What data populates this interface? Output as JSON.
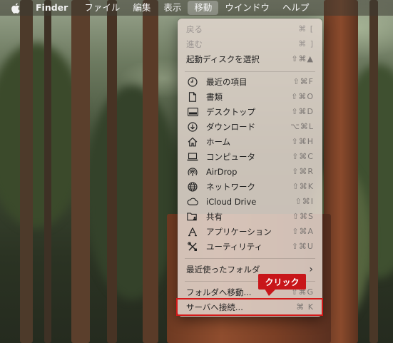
{
  "menubar": {
    "apple_icon": "apple-logo-icon",
    "app_name": "Finder",
    "items": [
      "ファイル",
      "編集",
      "表示",
      "移動",
      "ウインドウ",
      "ヘルプ"
    ],
    "active": "移動"
  },
  "menu": {
    "back": {
      "label": "戻る",
      "shortcut": "⌘ ["
    },
    "forward": {
      "label": "進む",
      "shortcut": "⌘ ]"
    },
    "startup_disk": {
      "label": "起動ディスクを選択",
      "shortcut": "⇧⌘▲"
    },
    "locations": [
      {
        "label": "最近の項目",
        "shortcut": "⇧⌘F",
        "icon": "clock-icon"
      },
      {
        "label": "書類",
        "shortcut": "⇧⌘O",
        "icon": "document-icon"
      },
      {
        "label": "デスクトップ",
        "shortcut": "⇧⌘D",
        "icon": "desktop-icon"
      },
      {
        "label": "ダウンロード",
        "shortcut": "⌥⌘L",
        "icon": "download-icon"
      },
      {
        "label": "ホーム",
        "shortcut": "⇧⌘H",
        "icon": "home-icon"
      },
      {
        "label": "コンピュータ",
        "shortcut": "⇧⌘C",
        "icon": "laptop-icon"
      },
      {
        "label": "AirDrop",
        "shortcut": "⇧⌘R",
        "icon": "airdrop-icon"
      },
      {
        "label": "ネットワーク",
        "shortcut": "⇧⌘K",
        "icon": "globe-icon"
      },
      {
        "label": "iCloud Drive",
        "shortcut": "⇧⌘I",
        "icon": "cloud-icon"
      },
      {
        "label": "共有",
        "shortcut": "⇧⌘S",
        "icon": "shared-folder-icon"
      },
      {
        "label": "アプリケーション",
        "shortcut": "⇧⌘A",
        "icon": "applications-icon"
      },
      {
        "label": "ユーティリティ",
        "shortcut": "⇧⌘U",
        "icon": "utilities-icon"
      }
    ],
    "recent_folders": {
      "label": "最近使ったフォルダ",
      "arrow": "›"
    },
    "go_to_folder": {
      "label": "フォルダへ移動...",
      "shortcut": "⇧⌘G"
    },
    "connect_server": {
      "label": "サーバへ接続...",
      "shortcut": "⌘ K"
    }
  },
  "callout": {
    "text": "クリック",
    "color": "#c8161a"
  }
}
